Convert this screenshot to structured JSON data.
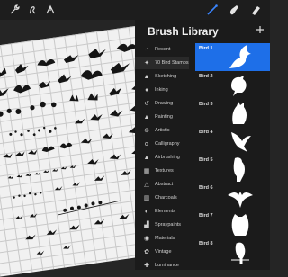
{
  "toolbar": {
    "left_icons": [
      "wrench-icon",
      "magic-wand-icon",
      "selection-arrow-icon"
    ],
    "right_icons": [
      "brush-icon",
      "smudge-icon",
      "eraser-icon"
    ],
    "active_tool": "brush"
  },
  "panel": {
    "title": "Brush Library",
    "categories": [
      {
        "label": "Recent",
        "icon": "recent"
      },
      {
        "label": "70 Bird Stamps",
        "icon": "bird-stamps",
        "active": true
      },
      {
        "label": "Sketching",
        "icon": "sketching"
      },
      {
        "label": "Inking",
        "icon": "inking"
      },
      {
        "label": "Drawing",
        "icon": "drawing"
      },
      {
        "label": "Painting",
        "icon": "painting"
      },
      {
        "label": "Artistic",
        "icon": "artistic"
      },
      {
        "label": "Calligraphy",
        "icon": "calligraphy"
      },
      {
        "label": "Airbrushing",
        "icon": "airbrushing"
      },
      {
        "label": "Textures",
        "icon": "textures"
      },
      {
        "label": "Abstract",
        "icon": "abstract"
      },
      {
        "label": "Charcoals",
        "icon": "charcoals"
      },
      {
        "label": "Elements",
        "icon": "elements"
      },
      {
        "label": "Spraypaints",
        "icon": "spraypaints"
      },
      {
        "label": "Materials",
        "icon": "materials"
      },
      {
        "label": "Vintage",
        "icon": "vintage"
      },
      {
        "label": "Luminance",
        "icon": "luminance"
      }
    ],
    "brushes": [
      {
        "label": "Bird 1",
        "icon": "flying-bird-icon",
        "selected": true
      },
      {
        "label": "Bird 2",
        "icon": "perched-bird-icon"
      },
      {
        "label": "Bird 3",
        "icon": "owl-silhouette-icon"
      },
      {
        "label": "Bird 4",
        "icon": "swallow-icon"
      },
      {
        "label": "Bird 5",
        "icon": "parrot-icon"
      },
      {
        "label": "Bird 6",
        "icon": "eagle-icon"
      },
      {
        "label": "Bird 7",
        "icon": "owl-icon"
      },
      {
        "label": "Bird 8",
        "icon": "parrot-perched-icon"
      }
    ]
  },
  "colors": {
    "accent": "#1e6fe8",
    "panel_bg": "#1b1b1b",
    "canvas_bg": "#f1f1f1"
  }
}
